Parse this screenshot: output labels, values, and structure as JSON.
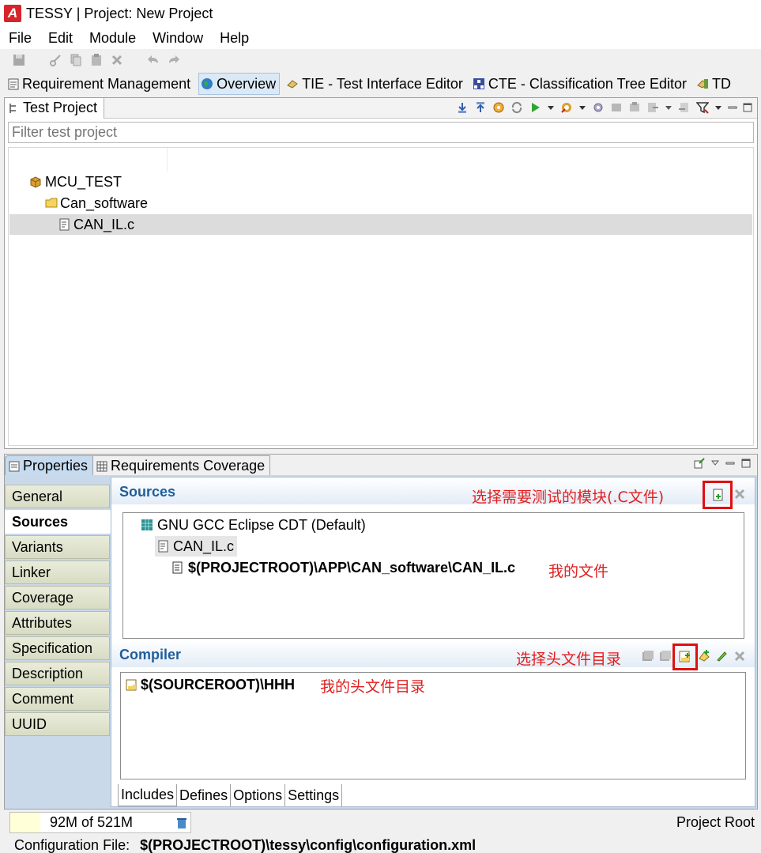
{
  "window": {
    "title": "TESSY | Project: New Project"
  },
  "menu": [
    "File",
    "Edit",
    "Module",
    "Window",
    "Help"
  ],
  "perspectives": [
    {
      "label": "Requirement Management",
      "icon": "requirement-icon",
      "active": false
    },
    {
      "label": "Overview",
      "icon": "globe-icon",
      "active": true
    },
    {
      "label": "TIE - Test Interface Editor",
      "icon": "tie-icon",
      "active": false
    },
    {
      "label": "CTE - Classification Tree Editor",
      "icon": "cte-icon",
      "active": false
    },
    {
      "label": "TD",
      "icon": "td-icon",
      "active": false
    }
  ],
  "test_project": {
    "tab_label": "Test Project",
    "filter_placeholder": "Filter test project",
    "tree": [
      {
        "label": "MCU_TEST",
        "icon": "package-icon",
        "level": 0
      },
      {
        "label": "Can_software",
        "icon": "folder-icon",
        "level": 1
      },
      {
        "label": "CAN_IL.c",
        "icon": "c-file-icon",
        "level": 2,
        "selected": true
      }
    ]
  },
  "properties": {
    "tabs": [
      {
        "label": "Properties",
        "icon": "properties-icon",
        "active": true
      },
      {
        "label": "Requirements Coverage",
        "icon": "table-icon",
        "active": false
      }
    ],
    "side_tabs": [
      "General",
      "Sources",
      "Variants",
      "Linker",
      "Coverage",
      "Attributes",
      "Specification",
      "Description",
      "Comment",
      "UUID"
    ],
    "active_side_tab": "Sources",
    "sources": {
      "title": "Sources",
      "annotation": "选择需要测试的模块(.C文件)",
      "items": [
        {
          "label": "GNU GCC Eclipse CDT (Default)",
          "icon": "compiler-icon"
        },
        {
          "label": "CAN_IL.c",
          "icon": "c-file-icon"
        },
        {
          "label": "$(PROJECTROOT)\\APP\\CAN_software\\CAN_IL.c",
          "icon": "file-icon"
        }
      ],
      "path_annotation": "我的文件"
    },
    "compiler": {
      "title": "Compiler",
      "annotation": "选择头文件目录",
      "items": [
        {
          "label": "$(SOURCEROOT)\\HHH",
          "icon": "include-folder-icon"
        }
      ],
      "item_annotation": "我的头文件目录",
      "tabs": [
        "Includes",
        "Defines",
        "Options",
        "Settings"
      ],
      "active_tab": "Includes"
    }
  },
  "status": {
    "memory": "92M of 521M",
    "project_root": "Project Root",
    "config_label": "Configuration File:",
    "config_path": "$(PROJECTROOT)\\tessy\\config\\configuration.xml"
  },
  "colors": {
    "annotation_red": "#e02020",
    "section_title_blue": "#1f5e9c",
    "tessy_red": "#d8232a"
  }
}
